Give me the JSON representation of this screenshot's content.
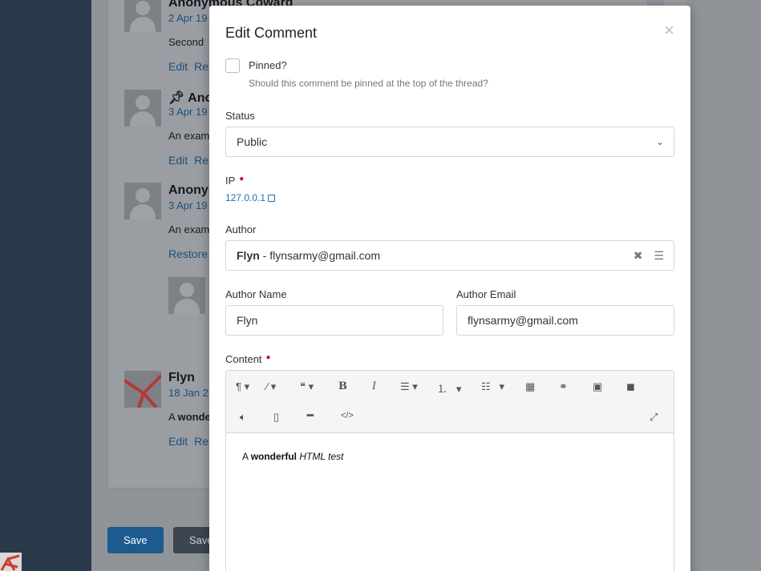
{
  "background": {
    "comments": [
      {
        "author": "Anonymous Coward",
        "date": "2 Apr 19",
        "text": "Second",
        "actions": [
          "Edit",
          "Rep"
        ]
      },
      {
        "author": "Anon",
        "date": "3 Apr 19",
        "text": "An exam",
        "actions": [
          "Edit",
          "Rep"
        ]
      },
      {
        "author": "Anonym",
        "date": "3 Apr 19",
        "text": "An exam",
        "actions": [
          "Restore"
        ]
      },
      {
        "author": "Flyn",
        "date": "18 Jan 2",
        "text_prefix": "A ",
        "text_bold": "wonde",
        "actions": [
          "Edit",
          "Rep"
        ]
      }
    ],
    "buttons": {
      "save": "Save",
      "save2": "Save"
    }
  },
  "modal": {
    "title": "Edit Comment",
    "close_glyph": "×",
    "pinned": {
      "label": "Pinned?",
      "help": "Should this comment be pinned at the top of the thread?",
      "checked": false
    },
    "status": {
      "label": "Status",
      "value": "Public"
    },
    "ip": {
      "label": "IP",
      "value": "127.0.0.1"
    },
    "author": {
      "label": "Author",
      "name": "Flyn",
      "email_part": " - flynsarmy@gmail.com"
    },
    "author_name": {
      "label": "Author Name",
      "value": "Flyn"
    },
    "author_email": {
      "label": "Author Email",
      "value": "flynsarmy@gmail.com"
    },
    "content": {
      "label": "Content",
      "prefix": "A ",
      "bold": "wonderful",
      "italic": "HTML test"
    }
  },
  "toolbar_icons": [
    "paragraph-icon",
    "magic-wand-icon",
    "quote-icon",
    "bold-icon",
    "italic-icon",
    "align-icon",
    "ordered-list-icon",
    "unordered-list-icon",
    "table-icon",
    "link-icon",
    "image-icon",
    "video-icon",
    "audio-icon",
    "file-icon",
    "horizontal-rule-icon",
    "code-icon",
    "fullscreen-icon"
  ]
}
